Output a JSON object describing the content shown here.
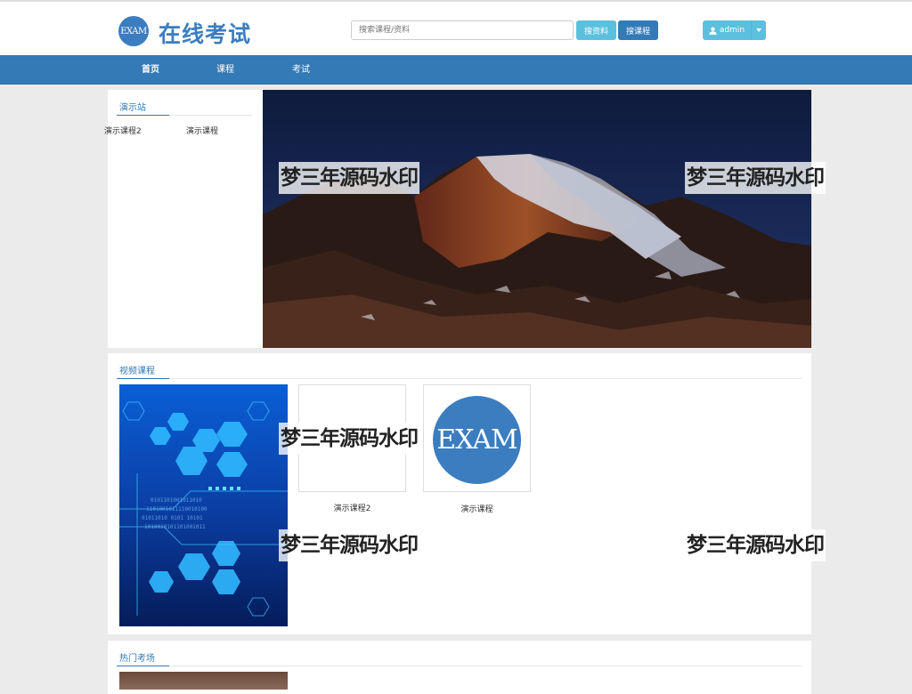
{
  "header": {
    "logo": "EXAM",
    "site_title": "在线考试",
    "search_placeholder": "搜索课程/资料",
    "search_materials_label": "搜资料",
    "search_courses_label": "搜课程",
    "user_label": "admin"
  },
  "nav": {
    "items": [
      {
        "label": "首页"
      },
      {
        "label": "课程"
      },
      {
        "label": "考试"
      }
    ]
  },
  "demo_site": {
    "title": "演示站",
    "links": [
      "演示课程2",
      "演示课程"
    ]
  },
  "video_courses": {
    "title": "视频课程",
    "items": [
      {
        "label": "演示课程2"
      },
      {
        "label": "演示课程",
        "thumb_text": "EXAM"
      }
    ]
  },
  "hot_exams": {
    "title": "热门考场"
  },
  "watermark": "梦三年源码水印",
  "colors": {
    "nav_bg": "#337ab7",
    "logo_blue": "#3b7dbf",
    "btn_info": "#5bc0de",
    "btn_primary": "#337ab7"
  }
}
